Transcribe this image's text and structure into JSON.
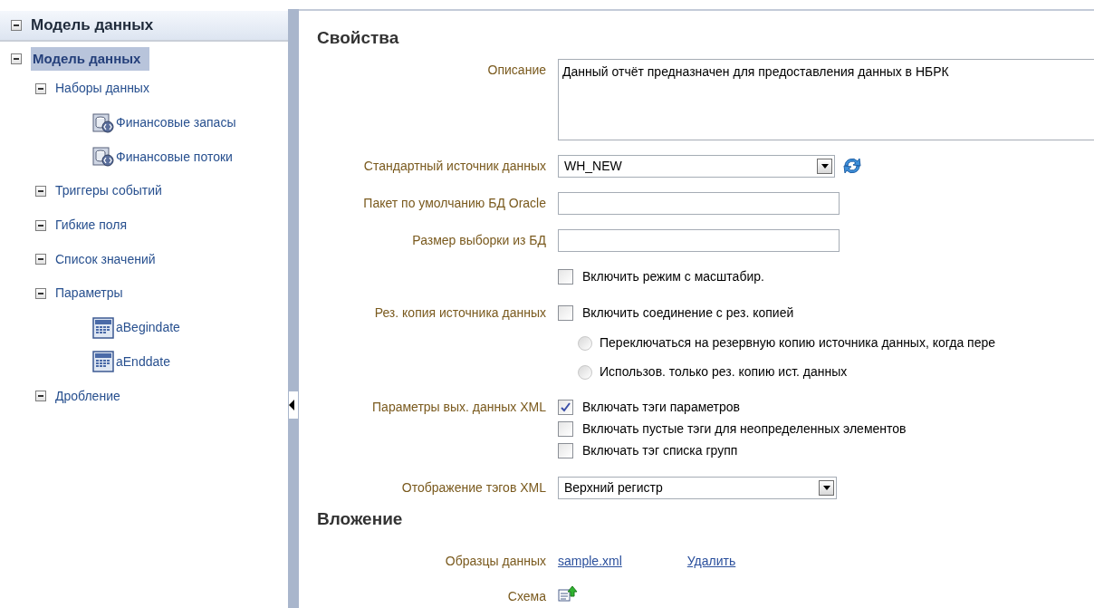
{
  "sidebar": {
    "title": "Модель данных",
    "expanded": true,
    "tree": [
      {
        "label": "Модель данных",
        "kind": "folder",
        "expanded": true,
        "selected": true,
        "children": [
          {
            "label": "Наборы данных",
            "kind": "folder",
            "expanded": true,
            "selected": false,
            "children": [
              {
                "label": "Финансовые запасы",
                "kind": "dataset",
                "selected": false
              },
              {
                "label": "Финансовые потоки",
                "kind": "dataset",
                "selected": false
              }
            ]
          },
          {
            "label": "Триггеры событий",
            "kind": "folder",
            "expanded": true,
            "selected": false
          },
          {
            "label": "Гибкие поля",
            "kind": "folder",
            "expanded": true,
            "selected": false
          },
          {
            "label": "Список значений",
            "kind": "folder",
            "expanded": true,
            "selected": false
          },
          {
            "label": "Параметры",
            "kind": "folder",
            "expanded": true,
            "selected": false,
            "children": [
              {
                "label": "aBegindate",
                "kind": "parameter",
                "selected": false
              },
              {
                "label": "aEnddate",
                "kind": "parameter",
                "selected": false
              }
            ]
          },
          {
            "label": "Дробление",
            "kind": "folder",
            "expanded": true,
            "selected": false
          }
        ]
      }
    ]
  },
  "sections": [
    {
      "title": "Свойства",
      "rows": [
        {
          "label": "Описание",
          "kind": "textarea",
          "value": "Данный отчёт предназначен для предоставления данных в НБРК"
        },
        {
          "label": "Стандартный источник данных",
          "kind": "select",
          "value": "WH_NEW",
          "refresh": true
        },
        {
          "label": "Пакет по умолчанию БД Oracle",
          "kind": "text"
        },
        {
          "label": "Размер выборки из БД",
          "kind": "text"
        },
        {
          "kind": "options",
          "options": [
            {
              "kind": "checkbox",
              "text": "Включить режим с масштабир.",
              "checked": false
            }
          ]
        },
        {
          "label": "Рез. копия источника данных",
          "kind": "options",
          "options": [
            {
              "kind": "checkbox",
              "text": "Включить соединение с рез. копией",
              "checked": false
            },
            {
              "kind": "radio",
              "text": "Переключаться на резервную копию источника данных, когда пере",
              "selected": false
            },
            {
              "kind": "radio",
              "text": "Использов. только рез. копию ист. данных",
              "selected": false
            }
          ]
        },
        {
          "label": "Параметры вых. данных XML",
          "kind": "options",
          "options": [
            {
              "kind": "checkbox",
              "text": "Включать тэги параметров",
              "checked": true
            },
            {
              "kind": "checkbox",
              "text": "Включать пустые тэги для неопределенных элементов",
              "checked": false
            },
            {
              "kind": "checkbox",
              "text": "Включать тэг списка групп",
              "checked": false
            }
          ]
        },
        {
          "label": "Отображение тэгов XML",
          "kind": "select",
          "value": "Верхний регистр",
          "refresh": false
        }
      ]
    },
    {
      "title": "Вложение",
      "rows": [
        {
          "label": "Образцы данных",
          "kind": "links",
          "links": [
            "sample.xml",
            "Удалить"
          ]
        },
        {
          "label": "Схема",
          "kind": "upload"
        }
      ]
    }
  ]
}
